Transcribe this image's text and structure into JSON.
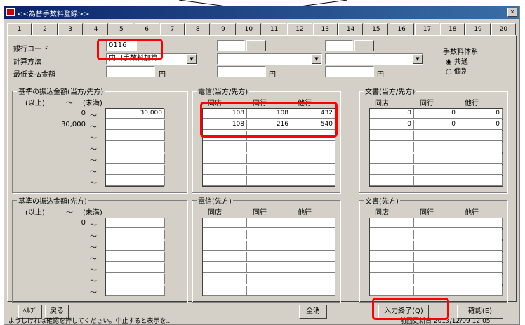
{
  "window": {
    "title": "<<為替手数料登録>>",
    "close_label": "x"
  },
  "tabs": [
    "1",
    "2",
    "3",
    "4",
    "5",
    "6",
    "7",
    "8",
    "9",
    "10",
    "11",
    "12",
    "13",
    "14",
    "15",
    "16",
    "17",
    "18",
    "19",
    "20"
  ],
  "header": {
    "bank_code_label": "銀行コード",
    "bank_code_value": "0116",
    "dots": "...",
    "calc_method_label": "計算方法",
    "calc_method_value": "内口手数料加算",
    "min_payment_label": "最低支払金額",
    "yen": "円",
    "fee_system_label": "手数料体系",
    "fee_system_options": [
      "共通",
      "個別"
    ]
  },
  "sections": {
    "base_amount_both": "基準の振込金額(当方/先方)",
    "telegraph_both": "電信(当方/先方)",
    "document_both": "文書(当方/先方)",
    "base_amount_other": "基準の振込金額(先方)",
    "telegraph_other": "電信(先方)",
    "document_other": "文書(先方)"
  },
  "columns": {
    "from_label": "(以上)",
    "tilde": "〜",
    "to_label": "(未満)",
    "same_branch": "同店",
    "same_bank": "同行",
    "other_bank": "他行"
  },
  "upper_amounts": {
    "rows": [
      {
        "from": "0",
        "to": "30,000"
      },
      {
        "from": "30,000",
        "to": ""
      }
    ]
  },
  "lower_amounts": {
    "rows": [
      {
        "from": "0",
        "to": ""
      }
    ]
  },
  "telegraph_both_values": [
    [
      "108",
      "108",
      "432"
    ],
    [
      "108",
      "216",
      "540"
    ]
  ],
  "document_both_values": [
    [
      "0",
      "0",
      "0"
    ],
    [
      "0",
      "0",
      "0"
    ]
  ],
  "buttons": {
    "help": "ﾍﾙﾌﾟ",
    "back": "戻る",
    "clear": "全消",
    "input_complete": "入力終了(Q)",
    "confirm": "確認(E)"
  },
  "status": {
    "message": "ようしければ確認を押してください。中止すると表示を...",
    "right": "前回更新日 2013/12/09 12:05"
  }
}
